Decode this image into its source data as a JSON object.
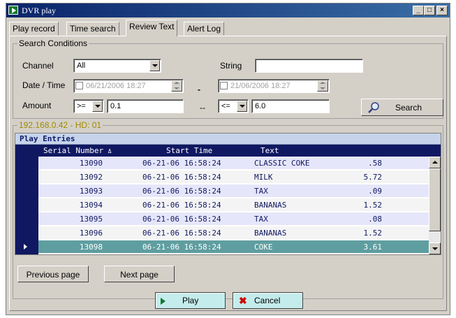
{
  "window": {
    "title": "DVR play"
  },
  "tabs": [
    {
      "label": "Play record"
    },
    {
      "label": "Time search"
    },
    {
      "label": "Review Text",
      "active": true
    },
    {
      "label": "Alert Log"
    }
  ],
  "search": {
    "legend": "Search Conditions",
    "channel_label": "Channel",
    "channel_value": "All",
    "string_label": "String",
    "string_value": "",
    "datetime_label": "Date / Time",
    "date_from": "06/21/2006 18:27",
    "date_sep": "-",
    "date_to": "21/06/2006  18:27",
    "amount_label": "Amount",
    "amount_op1": ">=",
    "amount_val1": "0.1",
    "amount_sep": "--",
    "amount_op2": "<=",
    "amount_val2": "6.0",
    "search_button": "Search"
  },
  "entries": {
    "legend": "192.168.0.42 - HD: 01",
    "title": "Play Entries",
    "columns": [
      "Serial Number",
      "Start Time",
      "Text"
    ],
    "sort_indicator": "Δ",
    "rows": [
      {
        "serial": "13090",
        "start": "06-21-06 16:58:24",
        "text": "CLASSIC COKE",
        "amount": ".58"
      },
      {
        "serial": "13092",
        "start": "06-21-06 16:58:24",
        "text": "MILK",
        "amount": "5.72"
      },
      {
        "serial": "13093",
        "start": "06-21-06 16:58:24",
        "text": "TAX",
        "amount": ".09"
      },
      {
        "serial": "13094",
        "start": "06-21-06 16:58:24",
        "text": "BANANAS",
        "amount": "1.52"
      },
      {
        "serial": "13095",
        "start": "06-21-06 16:58:24",
        "text": "TAX",
        "amount": ".08"
      },
      {
        "serial": "13096",
        "start": "06-21-06 16:58:24",
        "text": "BANANAS",
        "amount": "1.52"
      },
      {
        "serial": "13098",
        "start": "06-21-06 16:58:24",
        "text": "COKE",
        "amount": "3.61",
        "selected": true
      }
    ],
    "prev_button": "Previous page",
    "next_button": "Next page"
  },
  "footer": {
    "play_button": "Play",
    "cancel_button": "Cancel"
  },
  "colors": {
    "title_bar": "#0a246a",
    "grid_header": "#101862",
    "row_alt": "#e6e6fa",
    "row_selected": "#5f9ea0",
    "action_button": "#c4ecec"
  }
}
